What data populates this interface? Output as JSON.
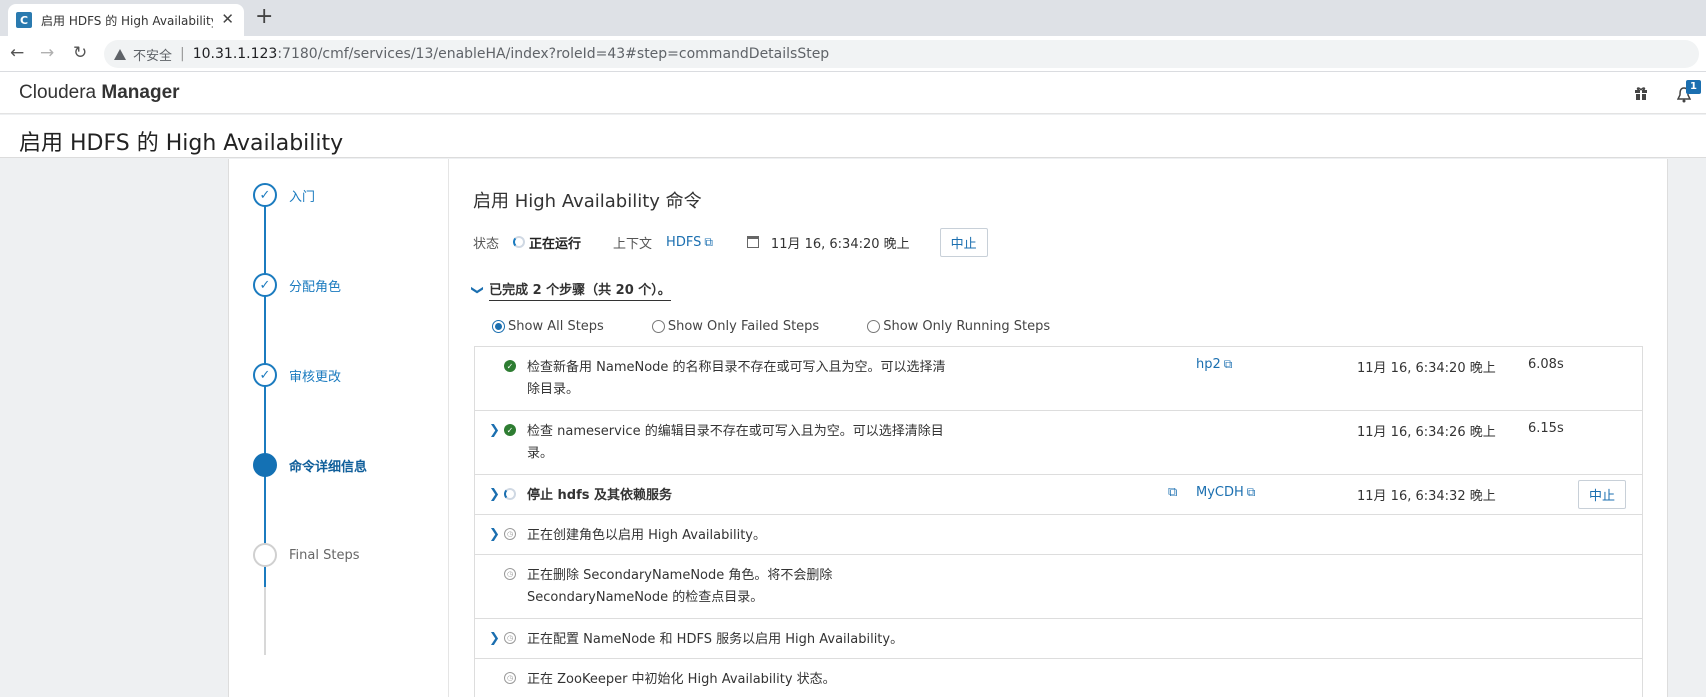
{
  "browser": {
    "tab_title": "启用 HDFS 的 High Availability",
    "favicon": "C",
    "security_label": "不安全",
    "url_host": "10.31.1.123",
    "url_rest": ":7180/cmf/services/13/enableHA/index?roleId=43#step=commandDetailsStep"
  },
  "header": {
    "brand_light": "Cloudera",
    "brand_bold": "Manager",
    "notification_count": "1"
  },
  "page": {
    "title": "启用 HDFS 的 High Availability"
  },
  "wizard": {
    "steps": [
      {
        "label": "入门",
        "state": "done"
      },
      {
        "label": "分配角色",
        "state": "done"
      },
      {
        "label": "审核更改",
        "state": "done"
      },
      {
        "label": "命令详细信息",
        "state": "active"
      },
      {
        "label": "Final Steps",
        "state": "future"
      }
    ]
  },
  "command": {
    "title": "启用 High Availability 命令",
    "status_label": "状态",
    "status_value": "正在运行",
    "context_label": "上下文",
    "context_value": "HDFS",
    "timestamp": "11月 16, 6:34:20 晚上",
    "abort_label": "中止",
    "progress_text": "已完成 2 个步骤（共 20 个）。"
  },
  "filters": [
    {
      "label": "Show All Steps",
      "selected": true
    },
    {
      "label": "Show Only Failed Steps",
      "selected": false
    },
    {
      "label": "Show Only Running Steps",
      "selected": false
    }
  ],
  "rows": [
    {
      "text": "检查新备用 NameNode 的名称目录不存在或可写入且为空。可以选择清除目录。",
      "host": "hp2",
      "time": "11月 16, 6:34:20 晚上",
      "duration": "6.08s",
      "status": "done",
      "expandable": false
    },
    {
      "text": "检查 nameservice 的编辑目录不存在或可写入且为空。可以选择清除目录。",
      "host": "",
      "time": "11月 16, 6:34:26 晚上",
      "duration": "6.15s",
      "status": "done",
      "expandable": true
    },
    {
      "text": "停止 hdfs 及其依赖服务",
      "host": "MyCDH",
      "time": "11月 16, 6:34:32 晚上",
      "duration": "",
      "status": "running",
      "expandable": true,
      "abort": "中止"
    },
    {
      "text": "正在创建角色以启用 High Availability。",
      "host": "",
      "time": "",
      "duration": "",
      "status": "pending",
      "expandable": true
    },
    {
      "text": "正在删除 SecondaryNameNode 角色。将不会删除 SecondaryNameNode 的检查点目录。",
      "host": "",
      "time": "",
      "duration": "",
      "status": "pending",
      "expandable": false
    },
    {
      "text": "正在配置 NameNode 和 HDFS 服务以启用 High Availability。",
      "host": "",
      "time": "",
      "duration": "",
      "status": "pending",
      "expandable": true
    },
    {
      "text": "正在 ZooKeeper 中初始化 High Availability 状态。",
      "host": "",
      "time": "",
      "duration": "",
      "status": "pending",
      "expandable": false
    }
  ]
}
